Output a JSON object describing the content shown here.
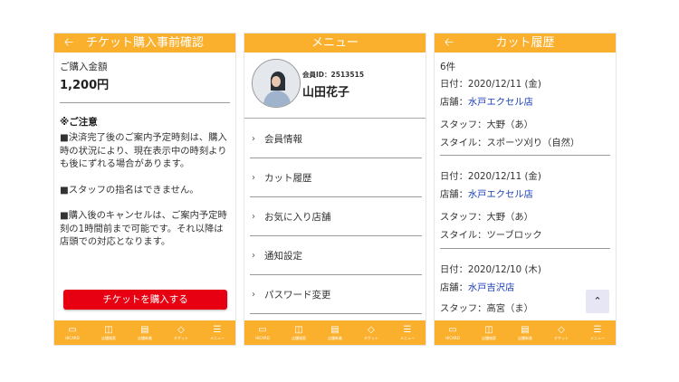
{
  "tabbar": {
    "items": [
      {
        "label": "HICARD",
        "icon": "card-icon"
      },
      {
        "label": "店舗検索",
        "icon": "monitor-icon"
      },
      {
        "label": "店舗新着",
        "icon": "chart-icon"
      },
      {
        "label": "チケット",
        "icon": "ticket-icon"
      },
      {
        "label": "メニュー",
        "icon": "menu-icon"
      }
    ]
  },
  "colors": {
    "accent": "#fbb02d",
    "buy_button": "#e60012",
    "link": "#1a3fb4"
  },
  "screen1": {
    "title": "チケット購入事前確認",
    "amount_label": "ご購入金額",
    "amount": "1,200円",
    "notice_title": "※ご注意",
    "notices": [
      "■決済完了後のご案内予定時刻は、購入時の状況により、現在表示中の時刻よりも後にずれる場合があります。",
      "■スタッフの指名はできません。",
      "■購入後のキャンセルは、ご案内予定時刻の1時間前まで可能です。それ以降は店頭での対応となります。"
    ],
    "buy_button": "チケットを購入する"
  },
  "screen2": {
    "title": "メニュー",
    "member_id": "会員ID：2513515",
    "member_name": "山田花子",
    "menu_items": [
      "会員情報",
      "カット履歴",
      "お気に入り店舗",
      "通知設定",
      "パスワード変更"
    ]
  },
  "screen3": {
    "title": "カット履歴",
    "count": "6件",
    "records": [
      {
        "date": "日付：2020/12/11 (金)",
        "shop_label": "店舗：",
        "shop": "水戸エクセル店",
        "staff": "スタッフ：大野（あ）",
        "style": "スタイル：スポーツ刈り（自然）"
      },
      {
        "date": "日付：2020/12/11 (金)",
        "shop_label": "店舗：",
        "shop": "水戸エクセル店",
        "staff": "スタッフ：大野（あ）",
        "style": "スタイル：ツーブロック"
      },
      {
        "date": "日付：2020/12/10 (木)",
        "shop_label": "店舗：",
        "shop": "水戸吉沢店",
        "staff": "スタッフ：高宮（ま）",
        "style": ""
      }
    ]
  }
}
